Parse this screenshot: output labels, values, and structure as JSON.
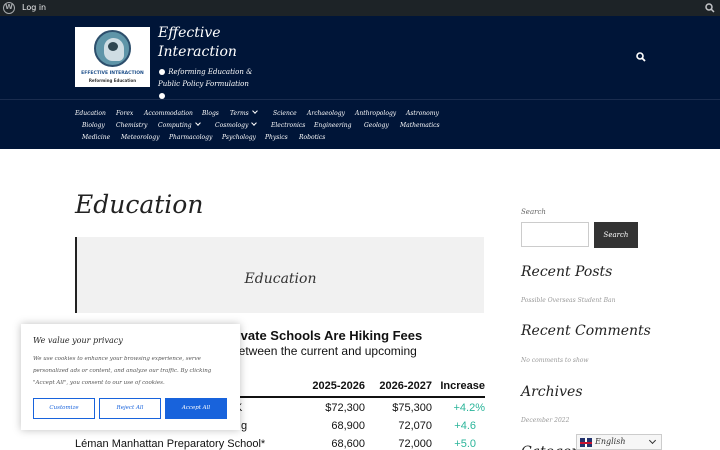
{
  "admin_bar": {
    "login": "Log in"
  },
  "site": {
    "logo_text1": "EFFECTIVE INTERACTION",
    "logo_text2": "Reforming Education",
    "title": "Effective Interaction",
    "description": "Reforming Education & Public Policy Formulation"
  },
  "nav": {
    "row1": [
      "Education",
      "Forex",
      "Accommodation",
      "Blogs",
      "Terms",
      "Science",
      "Archaeology",
      "Anthropology",
      "Astronomy"
    ],
    "row2": [
      "Biology",
      "Chemistry",
      "Computing",
      "Cosmology",
      "Electronics",
      "Engineering",
      "Geology",
      "Mathematics"
    ],
    "row3": [
      "Medicine",
      "Meteorology",
      "Pharmacology",
      "Psychology",
      "Physics",
      "Robotics"
    ]
  },
  "main": {
    "page_title": "Education",
    "banner_label": "Education",
    "article_heading": "rivate Schools Are Hiking Fees",
    "article_sub": "between the current and upcoming",
    "table": {
      "headers": [
        "",
        "2025-2026",
        "2026-2027",
        "Increase"
      ],
      "rows": [
        [
          "",
          "$72,300",
          "$75,300",
          "+4.2%"
        ],
        [
          "",
          "68,900",
          "72,070",
          "+4.6"
        ],
        [
          "Léman Manhattan Preparatory School*",
          "68,600",
          "72,000",
          "+5.0"
        ]
      ],
      "row1_fragment": "K",
      "row2_fragment": "g"
    }
  },
  "sidebar": {
    "search_label": "Search",
    "search_button": "Search",
    "recent_posts": "Recent Posts",
    "recent_post_item": "Possible Overseas Student Ban",
    "recent_comments": "Recent Comments",
    "no_comments": "No comments to show",
    "archives": "Archives",
    "archive_item": "December 2022",
    "categories": "Categories"
  },
  "cookie": {
    "title": "We value your privacy",
    "body": "We use cookies to enhance your browsing experience, serve personalized ads or content, and analyze our traffic. By clicking \"Accept All\", you consent to our use of cookies.",
    "customize": "Customize",
    "reject": "Reject All",
    "accept": "Accept All"
  },
  "translate": {
    "language": "English"
  },
  "colors": {
    "header_bg": "#001538",
    "accept_blue": "#1863dc",
    "increase_green": "#2bb59a"
  }
}
